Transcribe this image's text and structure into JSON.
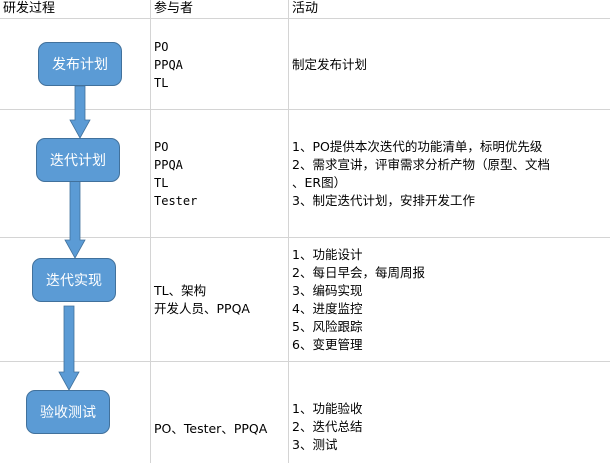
{
  "headers": {
    "process": "研发过程",
    "participants": "参与者",
    "activities": "活动"
  },
  "rows": [
    {
      "step": "发布计划",
      "participants": [
        "PO",
        "PPQA",
        "TL"
      ],
      "activities": [
        "制定发布计划"
      ]
    },
    {
      "step": "迭代计划",
      "participants": [
        "PO",
        "PPQA",
        "TL",
        "Tester"
      ],
      "activities": [
        "1、PO提供本次迭代的功能清单，标明优先级",
        "2、需求宣讲，评审需求分析产物（原型、文档",
        "、ER图）",
        "3、制定迭代计划，安排开发工作"
      ]
    },
    {
      "step": "迭代实现",
      "participants": [
        "TL、架构",
        "开发人员、PPQA"
      ],
      "activities": [
        "1、功能设计",
        "2、每日早会，每周周报",
        "3、编码实现",
        "4、进度监控",
        "5、风险跟踪",
        "6、变更管理"
      ]
    },
    {
      "step": "验收测试",
      "participants": [
        "PO、Tester、PPQA"
      ],
      "activities": [
        "1、功能验收",
        "2、迭代总结",
        "3、测试"
      ]
    }
  ],
  "colors": {
    "box_fill": "#5b9bd5",
    "box_border": "#41719c",
    "arrow": "#5b9bd5",
    "grid": "#d4d4d4"
  }
}
